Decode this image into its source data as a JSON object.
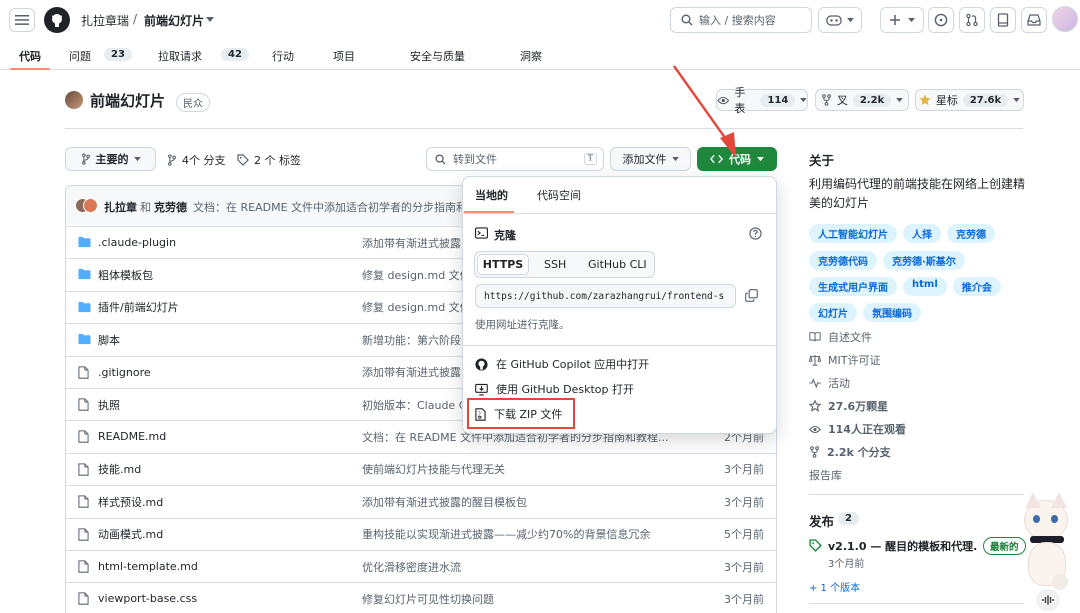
{
  "header": {
    "owner": "扎拉章瑞",
    "separator": "/",
    "repo": "前端幻灯片",
    "search_placeholder": "输入 / 搜索内容",
    "search_key": "/"
  },
  "tabs": [
    {
      "label": "代码",
      "count": ""
    },
    {
      "label": "问题",
      "count": "23"
    },
    {
      "label": "拉取请求",
      "count": "42"
    },
    {
      "label": "行动",
      "count": ""
    },
    {
      "label": "项目",
      "count": ""
    },
    {
      "label": "安全与质量",
      "count": ""
    },
    {
      "label": "洞察",
      "count": ""
    }
  ],
  "repo": {
    "title": "前端幻灯片",
    "visibility": "民众",
    "watch_label": "手表",
    "watch_count": "114",
    "fork_label": "叉",
    "fork_count": "2.2k",
    "star_label": "星标",
    "star_count": "27.6k"
  },
  "branchbar": {
    "branch": "主要的",
    "branches": "4个 分支",
    "tags": "2 个 标签",
    "goto_placeholder": "转到文件",
    "goto_key": "T",
    "add_file": "添加文件",
    "code_button": "代码"
  },
  "commit": {
    "author1": "扎拉章",
    "and": "和",
    "author2": "克劳德",
    "message": "文档：在 README 文件中添加适合初学者的分步指南和"
  },
  "files": [
    {
      "name": ".claude-plugin",
      "type": "folder",
      "msg": "添加带有渐进式披露",
      "time": ""
    },
    {
      "name": "粗体模板包",
      "type": "folder",
      "msg": "修复 design.md 文件",
      "time": ""
    },
    {
      "name": "插件/前端幻灯片",
      "type": "folder",
      "msg": "修复 design.md 文件",
      "time": ""
    },
    {
      "name": "脚本",
      "type": "folder",
      "msg": "新增功能：第六阶段",
      "time": ""
    },
    {
      "name": ".gitignore",
      "type": "file",
      "msg": "添加带有渐进式披露",
      "time": ""
    },
    {
      "name": "执照",
      "type": "file",
      "msg": "初始版本：Claude C",
      "time": ""
    },
    {
      "name": "README.md",
      "type": "file",
      "msg": "文档：在 README 文件中添加适合初学者的分步指南和教程...",
      "time": "2个月前"
    },
    {
      "name": "技能.md",
      "type": "file",
      "msg": "使前端幻灯片技能与代理无关",
      "time": "3个月前"
    },
    {
      "name": "样式预设.md",
      "type": "file",
      "msg": "添加带有渐进式披露的醒目模板包",
      "time": "3个月前"
    },
    {
      "name": "动画模式.md",
      "type": "file",
      "msg": "重构技能以实现渐进式披露——减少约70%的背景信息冗余",
      "time": "5个月前"
    },
    {
      "name": "html-template.md",
      "type": "file",
      "msg": "优化滑移密度进水流",
      "time": "3个月前"
    },
    {
      "name": "viewport-base.css",
      "type": "file",
      "msg": "修复幻灯片可见性切换问题",
      "time": "3个月前"
    }
  ],
  "dropdown": {
    "tab_local": "当地的",
    "tab_codespace": "代码空间",
    "clone_title": "克隆",
    "proto_https": "HTTPS",
    "proto_ssh": "SSH",
    "proto_cli": "GitHub CLI",
    "clone_url": "https://github.com/zarazhangrui/frontend-s",
    "clone_hint": "使用网址进行克隆。",
    "copilot": "在 GitHub Copilot 应用中打开",
    "desktop": "使用 GitHub Desktop 打开",
    "zip": "下载 ZIP 文件"
  },
  "about": {
    "title": "关于",
    "description": "利用编码代理的前端技能在网络上创建精美的幻灯片",
    "topics": [
      [
        "人工智能幻灯片",
        "人择",
        "克劳德"
      ],
      [
        "克劳德代码",
        "克劳德·斯基尔"
      ],
      [
        "生成式用户界面",
        "html",
        "推介会"
      ],
      [
        "幻灯片",
        "氛围编码"
      ]
    ],
    "readme": "自述文件",
    "license": "MIT许可证",
    "activity": "活动",
    "stars": "27.6万颗星",
    "watching": "114人正在观看",
    "forks": "2.2k 个分支",
    "report": "报告库"
  },
  "releases": {
    "title": "发布",
    "count": "2",
    "latest_name": "v2.1.0 — 醒目的模板和代理...",
    "latest_badge": "最新的",
    "latest_time": "3个月前",
    "more": "+ 1 个版本"
  },
  "colors": {
    "accent_green": "#1f883d",
    "link_blue": "#0969da",
    "tab_underline": "#fd8c73",
    "annotation_red": "#e5463a"
  }
}
